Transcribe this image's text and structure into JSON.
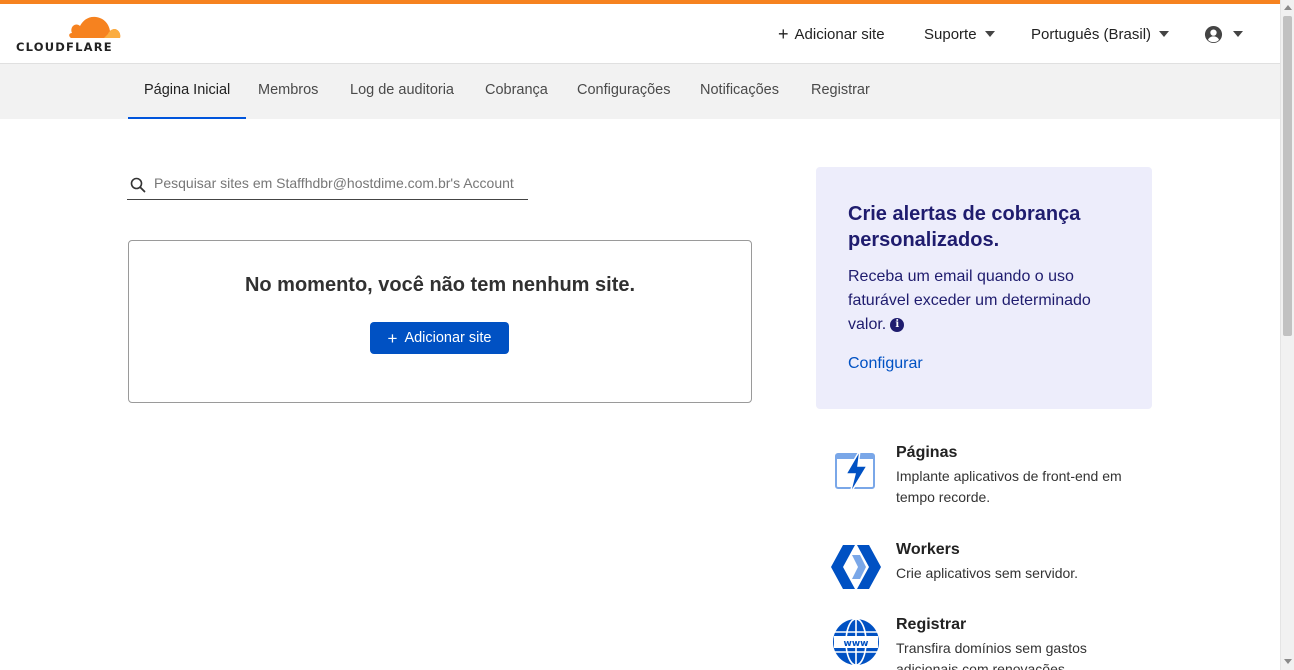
{
  "colors": {
    "brand_orange": "#f6821f",
    "primary_blue": "#0051c3",
    "promo_background": "#ededfb",
    "promo_text": "#1f1c6e",
    "tab_active_underline": "#0055dc"
  },
  "header": {
    "logo_text": "CLOUDFLARE",
    "add_site": "Adicionar site",
    "support": "Suporte",
    "language": "Português (Brasil)",
    "account_icon": "user-circle-icon"
  },
  "tabs": [
    {
      "label": "Página Inicial",
      "active": true
    },
    {
      "label": "Membros"
    },
    {
      "label": "Log de auditoria"
    },
    {
      "label": "Cobrança"
    },
    {
      "label": "Configurações"
    },
    {
      "label": "Notificações"
    },
    {
      "label": "Registrar"
    }
  ],
  "search": {
    "placeholder": "Pesquisar sites em Staffhdbr@hostdime.com.br's Account",
    "value": "",
    "icon": "search-icon"
  },
  "empty_state": {
    "title": "No momento, você não tem nenhum site.",
    "button_label": "Adicionar site"
  },
  "promo": {
    "title": "Crie alertas de cobrança personalizados.",
    "body": "Receba um email quando o uso faturável exceder um determinado valor.",
    "info_icon": "info-icon",
    "link": "Configurar"
  },
  "products": [
    {
      "name": "Páginas",
      "description": "Implante aplicativos de front-end em tempo recorde.",
      "icon": "pages-lightning-icon"
    },
    {
      "name": "Workers",
      "description": "Crie aplicativos sem servidor.",
      "icon": "workers-icon"
    },
    {
      "name": "Registrar",
      "description": "Transfira domínios sem gastos adicionais com renovações.",
      "icon": "www-globe-icon"
    }
  ]
}
